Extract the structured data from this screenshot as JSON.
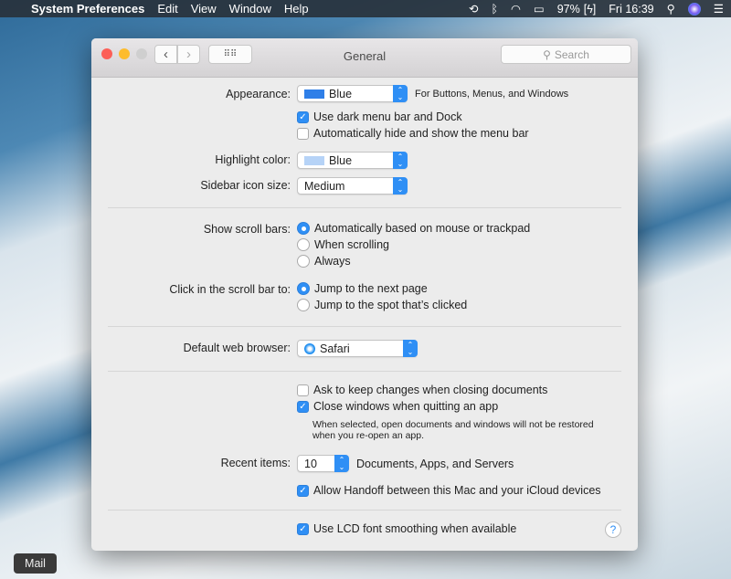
{
  "menubar": {
    "app": "System Preferences",
    "items": [
      "Edit",
      "View",
      "Window",
      "Help"
    ],
    "battery": "97%",
    "clock": "Fri 16:39"
  },
  "window": {
    "title": "General",
    "search_placeholder": "Search"
  },
  "appearance": {
    "label": "Appearance:",
    "value": "Blue",
    "swatch": "#2f7fe8",
    "note": "For Buttons, Menus, and Windows"
  },
  "dark_menu": {
    "label": "Use dark menu bar and Dock",
    "checked": true
  },
  "auto_hide": {
    "label": "Automatically hide and show the menu bar",
    "checked": false
  },
  "highlight": {
    "label": "Highlight color:",
    "value": "Blue",
    "swatch": "#b6d3f7"
  },
  "sidebar_size": {
    "label": "Sidebar icon size:",
    "value": "Medium"
  },
  "scroll_bars": {
    "label": "Show scroll bars:",
    "options": [
      "Automatically based on mouse or trackpad",
      "When scrolling",
      "Always"
    ],
    "selected": 0
  },
  "click_scroll": {
    "label": "Click in the scroll bar to:",
    "options": [
      "Jump to the next page",
      "Jump to the spot that’s clicked"
    ],
    "selected": 0
  },
  "browser": {
    "label": "Default web browser:",
    "value": "Safari"
  },
  "ask_keep": {
    "label": "Ask to keep changes when closing documents",
    "checked": false
  },
  "close_windows": {
    "label": "Close windows when quitting an app",
    "checked": true,
    "note1": "When selected, open documents and windows will not be restored",
    "note2": "when you re-open an app."
  },
  "recent": {
    "label": "Recent items:",
    "value": "10",
    "note": "Documents, Apps, and Servers"
  },
  "handoff": {
    "label": "Allow Handoff between this Mac and your iCloud devices",
    "checked": true
  },
  "lcd": {
    "label": "Use LCD font smoothing when available",
    "checked": true
  },
  "help": "?",
  "dock_tooltip": "Mail",
  "accent": "#2f8ff5"
}
